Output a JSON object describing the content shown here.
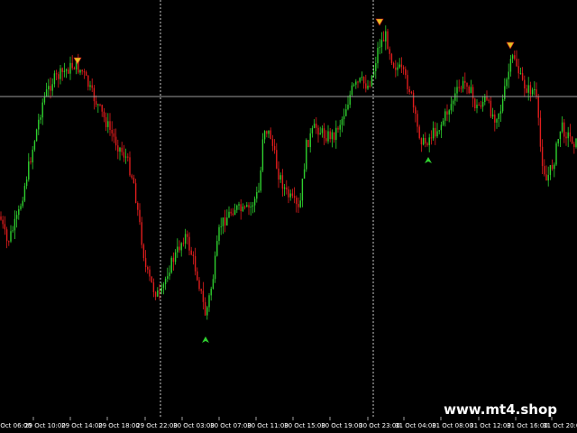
{
  "watermark": "www.mt4.shop",
  "colors": {
    "background": "#000000",
    "bull": "#2fd02f",
    "bear": "#e01d1d",
    "grid_line": "#c8c8c8",
    "axis_text": "#ffffff",
    "up_arrow": "#2fd02f",
    "down_arrow": "#e0c020"
  },
  "time_axis": {
    "labels": [
      "29 Oct 06:00",
      "29 Oct 10:00",
      "29 Oct 14:00",
      "29 Oct 18:00",
      "29 Oct 22:00",
      "30 Oct 03:00",
      "30 Oct 07:00",
      "30 Oct 11:00",
      "30 Oct 15:00",
      "30 Oct 19:00",
      "30 Oct 23:00",
      "31 Oct 04:00",
      "31 Oct 08:00",
      "31 Oct 12:00",
      "31 Oct 16:00",
      "31 Oct 20:00"
    ]
  },
  "markers": {
    "vertical_separators": 2,
    "horizontal_level": 1
  },
  "signals": [
    {
      "type": "sell-arrow",
      "icon": "down-arrow-icon"
    },
    {
      "type": "buy-arrow",
      "icon": "up-arrow-icon"
    },
    {
      "type": "sell-arrow",
      "icon": "down-arrow-icon"
    },
    {
      "type": "buy-arrow",
      "icon": "up-arrow-icon"
    },
    {
      "type": "sell-arrow",
      "icon": "down-arrow-icon"
    }
  ]
}
